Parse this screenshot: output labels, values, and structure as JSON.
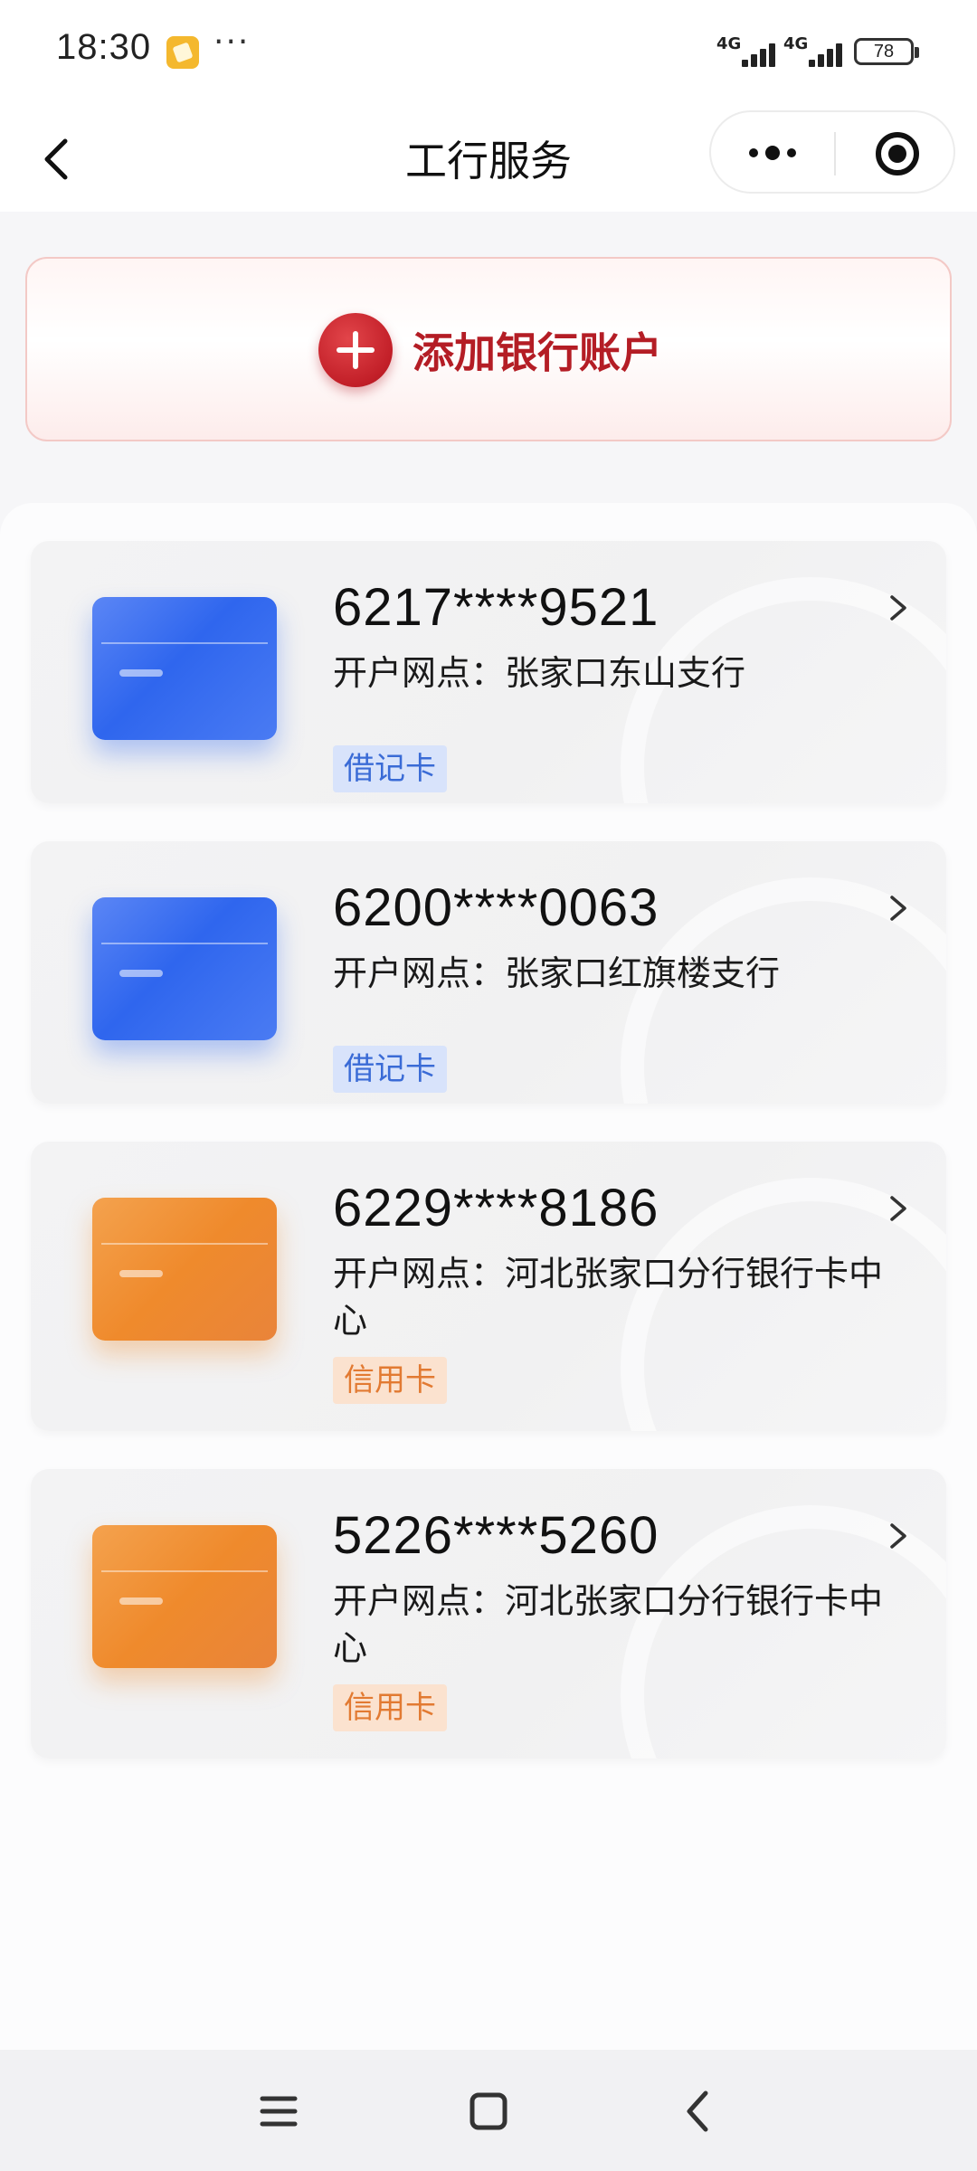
{
  "status_bar": {
    "time": "18:30",
    "more": "···",
    "network1": "4G",
    "network2": "4G",
    "battery": "78"
  },
  "nav": {
    "title": "工行服务"
  },
  "add_account": {
    "label": "添加银行账户"
  },
  "cards": [
    {
      "number": "6217****9521",
      "branch": "开户网点：张家口东山支行",
      "tag": "借记卡",
      "kind": "debit"
    },
    {
      "number": "6200****0063",
      "branch": "开户网点：张家口红旗楼支行",
      "tag": "借记卡",
      "kind": "debit"
    },
    {
      "number": "6229****8186",
      "branch": "开户网点：河北张家口分行银行卡中心",
      "tag": "信用卡",
      "kind": "credit"
    },
    {
      "number": "5226****5260",
      "branch": "开户网点：河北张家口分行银行卡中心",
      "tag": "信用卡",
      "kind": "credit"
    }
  ],
  "colors": {
    "accent_red": "#b41d25",
    "debit_blue": "#2f66ee",
    "credit_orange": "#ef8a2c"
  }
}
